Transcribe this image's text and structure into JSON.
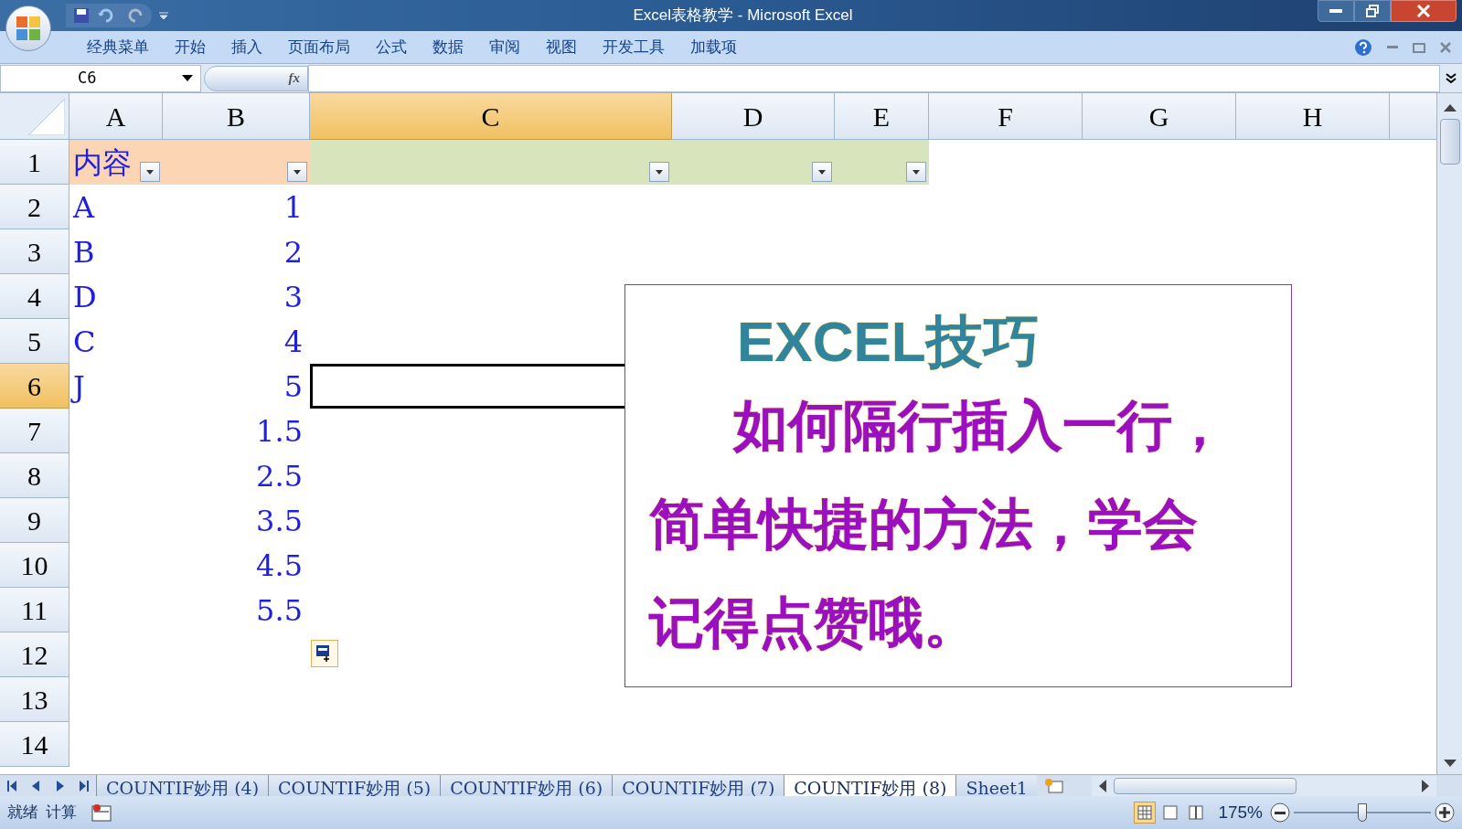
{
  "window": {
    "title": "Excel表格教学 - Microsoft Excel"
  },
  "menu": [
    "经典菜单",
    "开始",
    "插入",
    "页面布局",
    "公式",
    "数据",
    "审阅",
    "视图",
    "开发工具",
    "加载项"
  ],
  "formula_bar": {
    "name_box": "C6",
    "function_label": "fx"
  },
  "columns": [
    {
      "label": "A",
      "selected": false
    },
    {
      "label": "B",
      "selected": false
    },
    {
      "label": "C",
      "selected": true
    },
    {
      "label": "D",
      "selected": false
    },
    {
      "label": "E",
      "selected": false
    },
    {
      "label": "F",
      "selected": false
    },
    {
      "label": "G",
      "selected": false
    },
    {
      "label": "H",
      "selected": false
    }
  ],
  "rows": [
    {
      "label": "1",
      "selected": false,
      "kind": "filter",
      "a": "内容"
    },
    {
      "label": "2",
      "selected": false,
      "kind": "data",
      "a": "A",
      "b": "1"
    },
    {
      "label": "3",
      "selected": false,
      "kind": "data",
      "a": "B",
      "b": "2"
    },
    {
      "label": "4",
      "selected": false,
      "kind": "data",
      "a": "D",
      "b": "3"
    },
    {
      "label": "5",
      "selected": false,
      "kind": "data",
      "a": "C",
      "b": "4"
    },
    {
      "label": "6",
      "selected": true,
      "kind": "data",
      "a": "J",
      "b": "5"
    },
    {
      "label": "7",
      "selected": false,
      "kind": "data",
      "b": "1.5"
    },
    {
      "label": "8",
      "selected": false,
      "kind": "data",
      "b": "2.5"
    },
    {
      "label": "9",
      "selected": false,
      "kind": "data",
      "b": "3.5"
    },
    {
      "label": "10",
      "selected": false,
      "kind": "data",
      "b": "4.5"
    },
    {
      "label": "11",
      "selected": false,
      "kind": "data",
      "b": "5.5"
    },
    {
      "label": "12",
      "selected": false,
      "kind": "data"
    },
    {
      "label": "13",
      "selected": false,
      "kind": "data"
    },
    {
      "label": "14",
      "selected": false,
      "kind": "data"
    }
  ],
  "text_box": {
    "title": "EXCEL技巧",
    "body": "如何隔行插入一行，简单快捷的方法，学会记得点赞哦。"
  },
  "sheet_tabs": [
    {
      "label": "COUNTIF妙用 (4)",
      "selected": false
    },
    {
      "label": "COUNTIF妙用 (5)",
      "selected": false
    },
    {
      "label": "COUNTIF妙用 (6)",
      "selected": false
    },
    {
      "label": "COUNTIF妙用 (7)",
      "selected": false
    },
    {
      "label": "COUNTIF妙用 (8)",
      "selected": true
    },
    {
      "label": "Sheet1",
      "selected": false
    }
  ],
  "status_bar": {
    "items": [
      "就绪",
      "计算"
    ],
    "zoom": "175%",
    "zoom_slider": {
      "level": 0.5
    }
  }
}
